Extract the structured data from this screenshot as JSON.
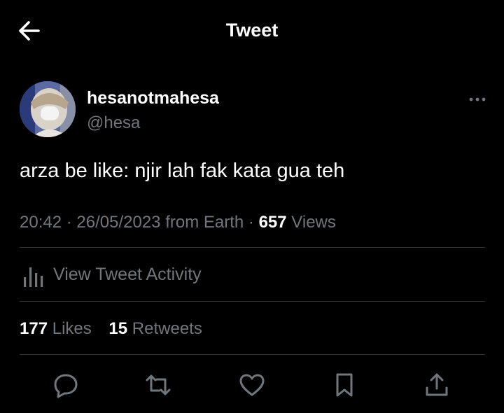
{
  "header": {
    "back_icon": "arrow-left-icon",
    "title": "Tweet"
  },
  "author": {
    "display_name": "hesanotmahesa",
    "handle": "@hesa",
    "more_icon": "ellipsis-icon"
  },
  "tweet": {
    "text": "arza be like: njir lah fak kata gua teh",
    "time": "20:42",
    "separator": "·",
    "date": "26/05/2023",
    "source": "from Earth",
    "views_count": "657",
    "views_label": "Views"
  },
  "activity": {
    "icon": "bar-chart-icon",
    "label": "View Tweet Activity"
  },
  "stats": {
    "likes_count": "177",
    "likes_label": "Likes",
    "retweets_count": "15",
    "retweets_label": "Retweets"
  },
  "actions": [
    {
      "name": "reply",
      "icon": "reply-bubble-icon"
    },
    {
      "name": "retweet",
      "icon": "retweet-icon"
    },
    {
      "name": "like",
      "icon": "heart-icon"
    },
    {
      "name": "bookmark",
      "icon": "bookmark-icon"
    },
    {
      "name": "share",
      "icon": "share-icon"
    }
  ],
  "colors": {
    "background": "#000000",
    "primary_text": "#ffffff",
    "secondary_text": "#71767b",
    "divider": "#2f3336"
  }
}
